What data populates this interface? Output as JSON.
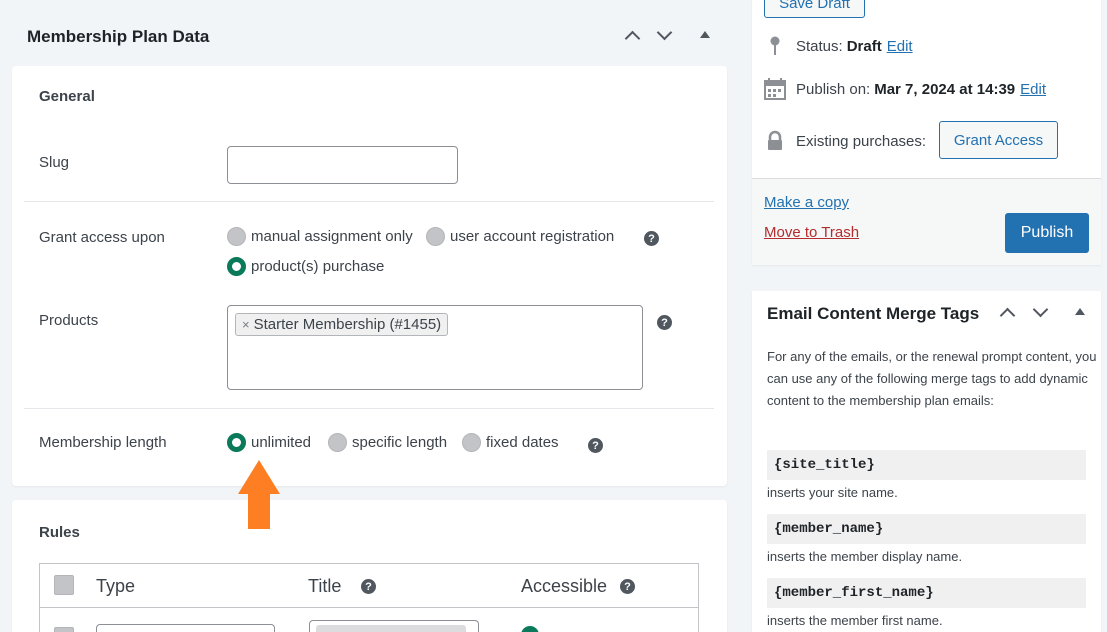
{
  "membership_plan": {
    "title": "Membership Plan Data",
    "general": {
      "section_title": "General",
      "slug_label": "Slug",
      "slug_value": "",
      "grant_label": "Grant access upon",
      "grant_options": [
        "manual assignment only",
        "user account registration",
        "product(s) purchase"
      ],
      "grant_selected": "product(s) purchase",
      "products_label": "Products",
      "product_token": "Starter Membership (#1455)",
      "token_remove": "×",
      "length_label": "Membership length",
      "length_options": [
        "unlimited",
        "specific length",
        "fixed dates"
      ],
      "length_selected": "unlimited"
    },
    "rules": {
      "section_title": "Rules",
      "columns": [
        "Type",
        "Title",
        "Accessible"
      ]
    },
    "help_glyph": "?"
  },
  "publish": {
    "save_draft": "Save Draft",
    "status_label": "Status:",
    "status_value": "Draft",
    "edit_label": "Edit",
    "publish_on_label": "Publish on:",
    "publish_on_value": "Mar 7, 2024 at 14:39",
    "existing_label": "Existing purchases:",
    "grant_access": "Grant Access",
    "make_copy": "Make a copy",
    "trash": "Move to Trash",
    "publish_btn": "Publish"
  },
  "merge_tags": {
    "title": "Email Content Merge Tags",
    "intro": "For any of the emails, or the renewal prompt content, you can use any of the following merge tags to add dynamic content to the membership plan emails:",
    "tags": [
      {
        "code": "{site_title}",
        "desc": "inserts your site name."
      },
      {
        "code": "{member_name}",
        "desc": "inserts the member display name."
      },
      {
        "code": "{member_first_name}",
        "desc": "inserts the member first name."
      }
    ]
  },
  "colors": {
    "accent": "#2271b1",
    "selected_radio": "#0a7a5a",
    "arrow": "#fd7e23",
    "trash": "#b32d2e"
  },
  "icons": [
    "chevron-up-icon",
    "chevron-down-icon",
    "toggle-triangle-icon",
    "help-icon",
    "pin-icon",
    "calendar-icon",
    "lock-icon",
    "arrow-up-icon"
  ]
}
